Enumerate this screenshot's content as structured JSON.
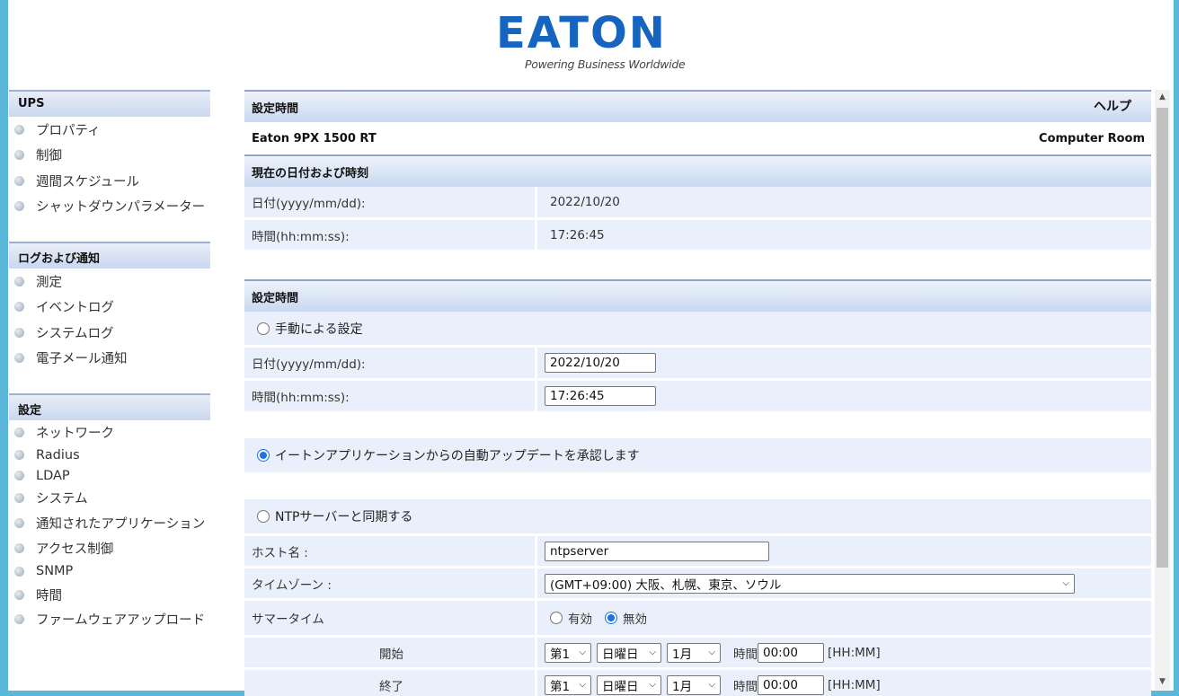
{
  "logo": {
    "word": "EATON",
    "tagline": "Powering Business Worldwide"
  },
  "sidebar": {
    "sections": [
      {
        "title": "UPS",
        "items": [
          "プロパティ",
          "制御",
          "週間スケジュール",
          "シャットダウンパラメーター"
        ]
      },
      {
        "title": "ログおよび通知",
        "items": [
          "測定",
          "イベントログ",
          "システムログ",
          "電子メール通知"
        ]
      },
      {
        "title": "設定",
        "items": [
          "ネットワーク",
          "Radius",
          "LDAP",
          "システム",
          "通知されたアプリケーション",
          "アクセス制御",
          "SNMP",
          "時間",
          "ファームウェアアップロード"
        ]
      }
    ]
  },
  "header": {
    "title": "設定時間",
    "help": "ヘルプ",
    "device": "Eaton 9PX 1500 RT",
    "location": "Computer Room"
  },
  "current": {
    "title": "現在の日付および時刻",
    "date_label": "日付(yyyy/mm/dd):",
    "date_value": "2022/10/20",
    "time_label": "時間(hh:mm:ss):",
    "time_value": "17:26:45"
  },
  "settings": {
    "title": "設定時間",
    "manual_label": "手動による設定",
    "date_label": "日付(yyyy/mm/dd):",
    "date_value": "2022/10/20",
    "time_label": "時間(hh:mm:ss):",
    "time_value": "17:26:45",
    "auto_label": "イートンアプリケーションからの自動アップデートを承認します",
    "ntp_label": "NTPサーバーと同期する",
    "host_label": "ホスト名 :",
    "host_value": "ntpserver",
    "tz_label": "タイムゾーン :",
    "tz_value": "(GMT+09:00) 大阪、札幌、東京、ソウル",
    "dst_label": "サマータイム",
    "dst_enabled": "有効",
    "dst_disabled": "無効",
    "start_label": "開始",
    "end_label": "終了",
    "week": "第1",
    "weekday": "日曜日",
    "month": "1月",
    "time_word": "時間",
    "time_hhmm": "00:00",
    "hhmm_hint": "[HH:MM]"
  },
  "colors": {
    "frame": "#5bb7d9",
    "brand": "#1565c0",
    "radio": "#1a73e8"
  }
}
